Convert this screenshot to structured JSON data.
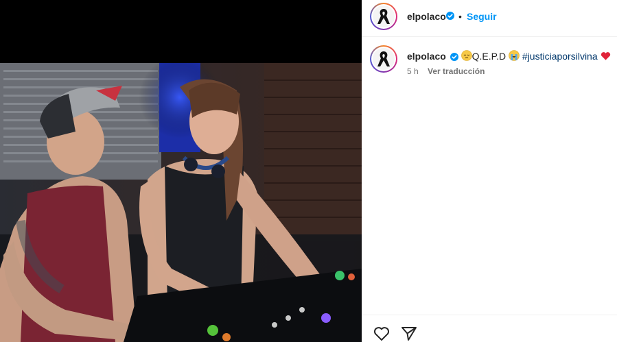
{
  "post": {
    "username": "elpolaco",
    "follow_label": "Seguir",
    "separator": "•"
  },
  "caption": {
    "username": "elpolaco",
    "text_main": "Q.E.P.D",
    "hashtag": "#justiciaporsilvina",
    "time": "5 h",
    "translate_label": "Ver traducción"
  },
  "icons": {
    "verified": "verified-badge-icon",
    "pensive": "pensive-face-emoji",
    "crying": "loudly-crying-face-emoji",
    "heart_emoji": "red-heart-emoji",
    "like": "heart-outline-icon",
    "share": "paper-plane-icon"
  },
  "colors": {
    "accent": "#0095f6",
    "hashtag": "#00376b",
    "muted": "#737373"
  }
}
